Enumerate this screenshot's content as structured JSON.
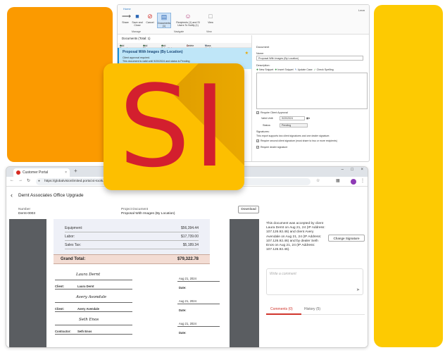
{
  "ribbon": {
    "tab_label": "Home",
    "user_label": "Leon",
    "buttons": [
      {
        "label": "Share"
      },
      {
        "label": "Save and Close"
      },
      {
        "label": "Cancel"
      },
      {
        "label": "Documents (1)"
      },
      {
        "label": "Recipients (1) and SI Users To Notify (1)"
      },
      {
        "label": "View"
      }
    ],
    "groups": [
      "Manage",
      "Navigate",
      "View"
    ]
  },
  "documents": {
    "header": "Documents (Total: 1)",
    "toolbar": [
      "Add Reports",
      "Add Files",
      "Add Submittals",
      "Delete",
      "Mass Update"
    ],
    "item": {
      "title": "Proposal With Images (By Location)",
      "line1": "Client approval required.",
      "line2": "This document is valid until 9/20/2024 and status is Pending"
    }
  },
  "doc_form": {
    "section": "Document",
    "name_label": "Name:",
    "name_value": "Proposal With Images (By Location)",
    "desc_label": "Description:",
    "desc_tools": [
      "New Snippet",
      "Insert Snippet",
      "Update Case",
      "Check Spelling"
    ],
    "require_approval": "Require Client Approval",
    "valid_until_label": "Valid Until:",
    "valid_until_value": "9/20/2024",
    "status_label": "Status:",
    "status_value": "Pending",
    "signatures_label": "Signatures:",
    "signatures_note": "This report supports two client signatures and one dealer signature.",
    "second_sig": "Require second client signature (must share to two or more recipients)",
    "dealer_sig": "Require dealer signature"
  },
  "logo": {
    "text": "SI"
  },
  "browser": {
    "tab_title": "Customer Portal",
    "url": "https://globalvisionlimited.portal.si-tools..."
  },
  "portal": {
    "title": "Dernt Associates Office Upgrade",
    "number_label": "Number",
    "number_value": "Dernt-0003",
    "project_doc_label": "Project Document",
    "project_doc_value": "Proposal With Images (By Location)",
    "download_label": "Download",
    "costs": [
      {
        "label": "Equipment:",
        "value": "$56,394.44"
      },
      {
        "label": "Labor:",
        "value": "$17,739.00"
      },
      {
        "label": "Sales Tax:",
        "value": "$5,189.34"
      }
    ],
    "grand_total_label": "Grand Total:",
    "grand_total_value": "$79,322.78",
    "signatures": [
      {
        "sig": "Laura Dernt",
        "name": "Laura Dernt",
        "role": "Client:",
        "date": "Aug 21, 2024"
      },
      {
        "sig": "Avery Avondale",
        "name": "Avery Avendale",
        "role": "Client:",
        "date": "Aug 21, 2024"
      },
      {
        "sig": "Seth Enos",
        "name": "Seth Enos",
        "role": "Contractor:",
        "date": "Aug 21, 2024"
      }
    ],
    "date_label": "Date:",
    "acceptance_note": "This document was accepted by client Laura Dernt on Aug 21, 24 (IP Address: 107.126.92.46) and client Avery Avendale on Aug 21, 24 (IP Address: 107.126.92.46) and by dealer Seth Enos on Aug 21, 24 (IP Address: 107.126.92.46).",
    "change_signature": "Change Signature",
    "comment_placeholder": "Write a comment",
    "tab_comments": "Comments (0)",
    "tab_history": "History (5)"
  }
}
